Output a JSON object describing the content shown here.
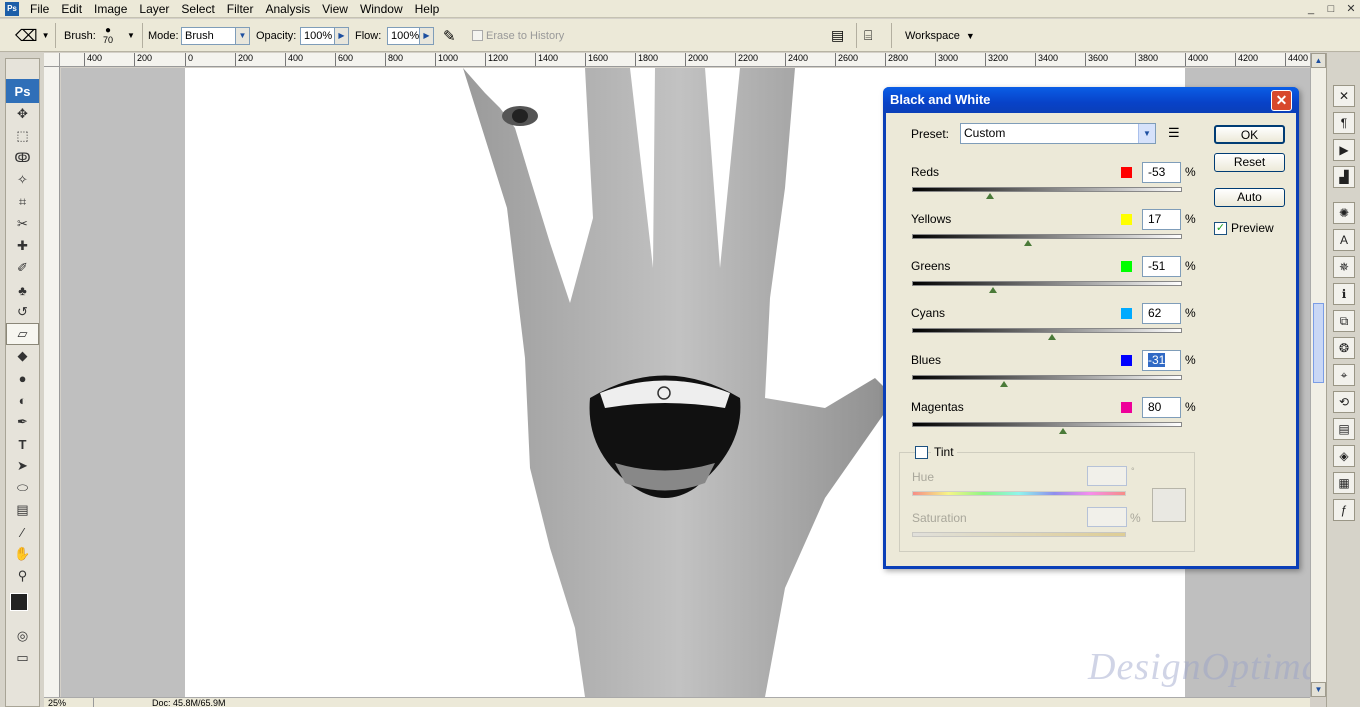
{
  "menubar": {
    "app_logo": "Ps",
    "items": [
      "File",
      "Edit",
      "Image",
      "Layer",
      "Select",
      "Filter",
      "Analysis",
      "View",
      "Window",
      "Help"
    ],
    "window_controls": [
      "_",
      "□",
      "✕"
    ]
  },
  "options": {
    "brush_label": "Brush:",
    "brush_size": "70",
    "mode_label": "Mode:",
    "mode_value": "Brush",
    "opacity_label": "Opacity:",
    "opacity_value": "100%",
    "flow_label": "Flow:",
    "flow_value": "100%",
    "erase_history_label": "Erase to History",
    "workspace_label": "Workspace"
  },
  "toolbox": {
    "logo": "Ps",
    "tools": [
      "move-icon",
      "marquee-icon",
      "lasso-icon",
      "magic-wand-icon",
      "crop-icon",
      "slice-icon",
      "healing-brush-icon",
      "brush-icon",
      "clone-stamp-icon",
      "history-brush-icon",
      "eraser-icon",
      "paint-bucket-icon",
      "blur-icon",
      "dodge-icon",
      "pen-icon",
      "type-icon",
      "path-selection-icon",
      "shape-icon",
      "notes-icon",
      "eyedropper-icon",
      "hand-icon",
      "zoom-icon"
    ],
    "active_tool": "eraser-icon"
  },
  "ruler": {
    "top_labels": [
      "400",
      "200",
      "0",
      "200",
      "400",
      "600",
      "800",
      "1000",
      "1200",
      "1400",
      "1600",
      "1800",
      "2000",
      "2200",
      "2400",
      "2600",
      "2800",
      "3000",
      "3200",
      "3400",
      "3600",
      "3800",
      "4000",
      "4200",
      "4400"
    ]
  },
  "status": {
    "zoom": "25%",
    "doc": "Doc: 45.8M/65.9M"
  },
  "watermark": "DesignOptimal.com",
  "dialog": {
    "title": "Black and White",
    "preset_label": "Preset:",
    "preset_value": "Custom",
    "buttons": {
      "ok": "OK",
      "reset": "Reset",
      "auto": "Auto"
    },
    "preview_label": "Preview",
    "preview_checked": true,
    "channels": [
      {
        "name": "Reds",
        "value": "-53",
        "color": "#ff0000",
        "slider_fraction": 0.29
      },
      {
        "name": "Yellows",
        "value": "17",
        "color": "#ffff00",
        "slider_fraction": 0.43
      },
      {
        "name": "Greens",
        "value": "-51",
        "color": "#00ff00",
        "slider_fraction": 0.3
      },
      {
        "name": "Cyans",
        "value": "62",
        "color": "#00aaff",
        "slider_fraction": 0.52
      },
      {
        "name": "Blues",
        "value": "-31",
        "color": "#0000ff",
        "slider_fraction": 0.34,
        "selected": true
      },
      {
        "name": "Magentas",
        "value": "80",
        "color": "#ee0099",
        "slider_fraction": 0.56
      }
    ],
    "percent_sign": "%",
    "tint": {
      "label": "Tint",
      "checked": false,
      "hue_label": "Hue",
      "hue_unit": "°",
      "saturation_label": "Saturation",
      "saturation_unit": "%"
    }
  }
}
